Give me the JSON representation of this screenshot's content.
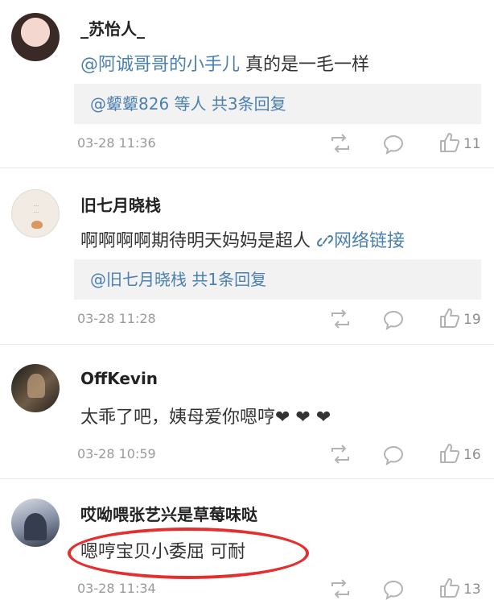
{
  "comments": [
    {
      "username": "_苏怡人_",
      "mention": "@阿诚哥哥的小手儿",
      "body": " 真的是一毛一样",
      "reply_summary": "@颦颦826 等人  共3条回复",
      "timestamp": "03-28 11:36",
      "likes": "11"
    },
    {
      "username": "旧七月晓栈",
      "body": "啊啊啊啊期待明天妈妈是超人 ",
      "link": "网络链接",
      "reply_summary": "@旧七月晓栈  共1条回复",
      "timestamp": "03-28 11:28",
      "likes": "19"
    },
    {
      "username": "OffKevin",
      "body": "太乖了吧，姨母爱你嗯哼❤ ❤ ❤",
      "timestamp": "03-28 10:59",
      "likes": "16"
    },
    {
      "username": "哎呦喂张艺兴是草莓味哒",
      "body": "嗯哼宝贝小委屈  可耐",
      "timestamp": "03-28 11:34",
      "likes": "13"
    }
  ],
  "colors": {
    "link": "#4a7fb0",
    "highlight_circle": "#e52f2f",
    "reply_bg": "#f2f2f2"
  },
  "icons": [
    "repost-icon",
    "comment-bubble-icon",
    "thumbs-up-icon",
    "link-icon"
  ]
}
